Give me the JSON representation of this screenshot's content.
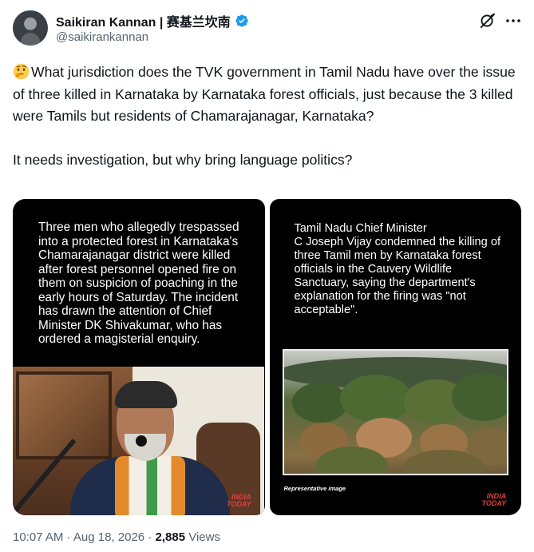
{
  "author": {
    "display_name": "Saikiran Kannan | 赛基兰坎南",
    "handle": "@saikirankannan"
  },
  "icons": {
    "avatar": "avatar-image",
    "verified": "verified-badge-icon",
    "grok": "grok-icon",
    "more": "more-options-icon",
    "emoji": "thinking-face-emoji"
  },
  "tweet": {
    "paragraph_1": "What jurisdiction does the TVK government in Tamil Nadu have over the issue of three killed in Karnataka by Karnataka forest officials, just because the 3 killed were Tamils but residents of Chamarajanagar, Karnataka?",
    "paragraph_2": "It needs investigation, but why bring language politics?"
  },
  "media": {
    "left": {
      "text": "Three men who allegedly trespassed into a protected forest in Karnataka's Chamarajanagar district were killed after forest personnel opened fire on them on suspicion of poaching in the early hours of Saturday. The incident has drawn the attention of Chief Minister DK Shivakumar, who has ordered a magisterial enquiry.",
      "logo_line1": "INDIA",
      "logo_line2": "TODAY"
    },
    "right": {
      "text_line1": "Tamil Nadu Chief Minister",
      "text_rest": "C Joseph Vijay condemned the killing of three Tamil men by Karnataka forest officials in the Cauvery Wildlife Sanctuary, saying the department's explanation for the firing was \"not acceptable\".",
      "caption": "Representative image",
      "logo_line1": "INDIA",
      "logo_line2": "TODAY"
    }
  },
  "meta": {
    "time": "10:07 AM",
    "separator": " · ",
    "date": "Aug 18, 2026",
    "views_count": "2,885",
    "views_label": " Views"
  },
  "colors": {
    "text_primary": "#0f1419",
    "text_secondary": "#536471",
    "verified_blue": "#1d9bf0",
    "media_background": "#000000",
    "brand_red": "#e43d3d"
  }
}
